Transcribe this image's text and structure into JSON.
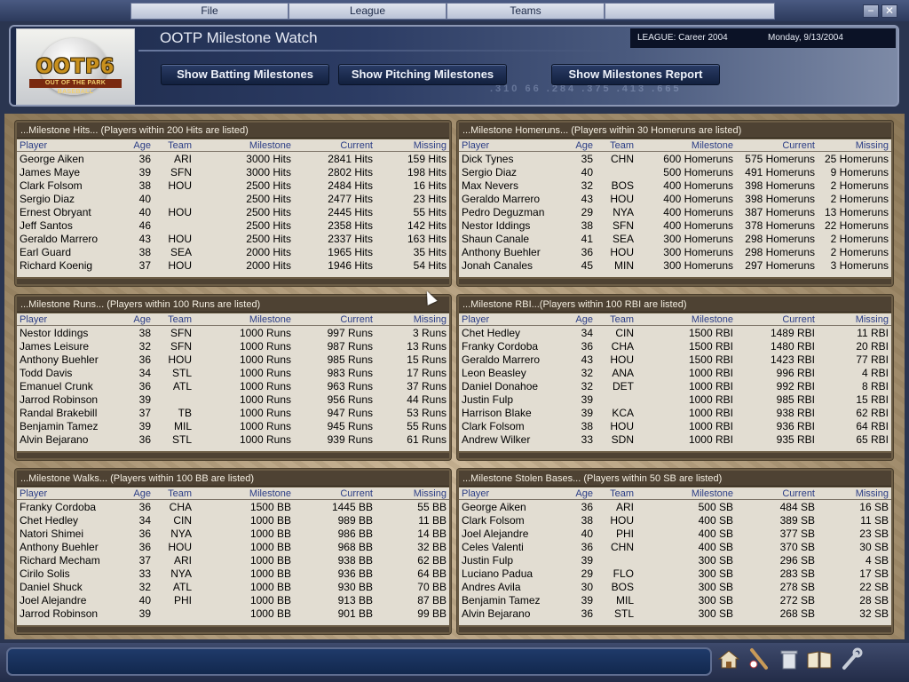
{
  "menu": {
    "items": [
      "File",
      "League",
      "Teams",
      ""
    ]
  },
  "window_controls": {
    "minimize": "−",
    "close": "✕"
  },
  "header": {
    "title": "OOTP Milestone Watch",
    "logo_text": "OOTP6",
    "logo_sub": "OUT OF THE PARK BASEBALL",
    "league": "LEAGUE: Career 2004",
    "date": "Monday, 9/13/2004",
    "buttons": {
      "batting": "Show Batting Milestones",
      "pitching": "Show Pitching Milestones",
      "report": "Show Milestones Report"
    },
    "bg_numbers": ".310  66  .284  .375  .413  .665"
  },
  "columns": {
    "player": "Player",
    "age": "Age",
    "team": "Team",
    "milestone": "Milestone",
    "current": "Current",
    "missing": "Missing"
  },
  "panels": {
    "hits": {
      "title": "...Milestone Hits... (Players within 200 Hits are listed)",
      "rows": [
        [
          "George Aiken",
          "36",
          "ARI",
          "3000 Hits",
          "2841 Hits",
          "159 Hits"
        ],
        [
          "James Maye",
          "39",
          "SFN",
          "3000 Hits",
          "2802 Hits",
          "198 Hits"
        ],
        [
          "Clark Folsom",
          "38",
          "HOU",
          "2500 Hits",
          "2484 Hits",
          "16 Hits"
        ],
        [
          "Sergio Diaz",
          "40",
          "",
          "2500 Hits",
          "2477 Hits",
          "23 Hits"
        ],
        [
          "Ernest Obryant",
          "40",
          "HOU",
          "2500 Hits",
          "2445 Hits",
          "55 Hits"
        ],
        [
          "Jeff Santos",
          "46",
          "",
          "2500 Hits",
          "2358 Hits",
          "142 Hits"
        ],
        [
          "Geraldo Marrero",
          "43",
          "HOU",
          "2500 Hits",
          "2337 Hits",
          "163 Hits"
        ],
        [
          "Earl Guard",
          "38",
          "SEA",
          "2000 Hits",
          "1965 Hits",
          "35 Hits"
        ],
        [
          "Richard Koenig",
          "37",
          "HOU",
          "2000 Hits",
          "1946 Hits",
          "54 Hits"
        ]
      ]
    },
    "homeruns": {
      "title": "...Milestone Homeruns... (Players within 30 Homeruns are listed)",
      "rows": [
        [
          "Dick Tynes",
          "35",
          "CHN",
          "600 Homeruns",
          "575 Homeruns",
          "25 Homeruns"
        ],
        [
          "Sergio Diaz",
          "40",
          "",
          "500 Homeruns",
          "491 Homeruns",
          "9 Homeruns"
        ],
        [
          "Max Nevers",
          "32",
          "BOS",
          "400 Homeruns",
          "398 Homeruns",
          "2 Homeruns"
        ],
        [
          "Geraldo Marrero",
          "43",
          "HOU",
          "400 Homeruns",
          "398 Homeruns",
          "2 Homeruns"
        ],
        [
          "Pedro Deguzman",
          "29",
          "NYA",
          "400 Homeruns",
          "387 Homeruns",
          "13 Homeruns"
        ],
        [
          "Nestor Iddings",
          "38",
          "SFN",
          "400 Homeruns",
          "378 Homeruns",
          "22 Homeruns"
        ],
        [
          "Shaun Canale",
          "41",
          "SEA",
          "300 Homeruns",
          "298 Homeruns",
          "2 Homeruns"
        ],
        [
          "Anthony Buehler",
          "36",
          "HOU",
          "300 Homeruns",
          "298 Homeruns",
          "2 Homeruns"
        ],
        [
          "Jonah Canales",
          "45",
          "MIN",
          "300 Homeruns",
          "297 Homeruns",
          "3 Homeruns"
        ]
      ]
    },
    "runs": {
      "title": "...Milestone Runs... (Players within 100 Runs are listed)",
      "rows": [
        [
          "Nestor Iddings",
          "38",
          "SFN",
          "1000 Runs",
          "997 Runs",
          "3 Runs"
        ],
        [
          "James Leisure",
          "32",
          "SFN",
          "1000 Runs",
          "987 Runs",
          "13 Runs"
        ],
        [
          "Anthony Buehler",
          "36",
          "HOU",
          "1000 Runs",
          "985 Runs",
          "15 Runs"
        ],
        [
          "Todd Davis",
          "34",
          "STL",
          "1000 Runs",
          "983 Runs",
          "17 Runs"
        ],
        [
          "Emanuel Crunk",
          "36",
          "ATL",
          "1000 Runs",
          "963 Runs",
          "37 Runs"
        ],
        [
          "Jarrod Robinson",
          "39",
          "",
          "1000 Runs",
          "956 Runs",
          "44 Runs"
        ],
        [
          "Randal Brakebill",
          "37",
          "TB",
          "1000 Runs",
          "947 Runs",
          "53 Runs"
        ],
        [
          "Benjamin Tamez",
          "39",
          "MIL",
          "1000 Runs",
          "945 Runs",
          "55 Runs"
        ],
        [
          "Alvin Bejarano",
          "36",
          "STL",
          "1000 Runs",
          "939 Runs",
          "61 Runs"
        ]
      ]
    },
    "rbi": {
      "title": "...Milestone RBI...(Players within 100 RBI are listed)",
      "rows": [
        [
          "Chet Hedley",
          "34",
          "CIN",
          "1500 RBI",
          "1489 RBI",
          "11 RBI"
        ],
        [
          "Franky Cordoba",
          "36",
          "CHA",
          "1500 RBI",
          "1480 RBI",
          "20 RBI"
        ],
        [
          "Geraldo Marrero",
          "43",
          "HOU",
          "1500 RBI",
          "1423 RBI",
          "77 RBI"
        ],
        [
          "Leon Beasley",
          "32",
          "ANA",
          "1000 RBI",
          "996 RBI",
          "4 RBI"
        ],
        [
          "Daniel Donahoe",
          "32",
          "DET",
          "1000 RBI",
          "992 RBI",
          "8 RBI"
        ],
        [
          "Justin Fulp",
          "39",
          "",
          "1000 RBI",
          "985 RBI",
          "15 RBI"
        ],
        [
          "Harrison Blake",
          "39",
          "KCA",
          "1000 RBI",
          "938 RBI",
          "62 RBI"
        ],
        [
          "Clark Folsom",
          "38",
          "HOU",
          "1000 RBI",
          "936 RBI",
          "64 RBI"
        ],
        [
          "Andrew Wilker",
          "33",
          "SDN",
          "1000 RBI",
          "935 RBI",
          "65 RBI"
        ]
      ]
    },
    "walks": {
      "title": "...Milestone Walks... (Players within 100 BB are listed)",
      "rows": [
        [
          "Franky Cordoba",
          "36",
          "CHA",
          "1500 BB",
          "1445 BB",
          "55 BB"
        ],
        [
          "Chet Hedley",
          "34",
          "CIN",
          "1000 BB",
          "989 BB",
          "11 BB"
        ],
        [
          "Natori Shimei",
          "36",
          "NYA",
          "1000 BB",
          "986 BB",
          "14 BB"
        ],
        [
          "Anthony Buehler",
          "36",
          "HOU",
          "1000 BB",
          "968 BB",
          "32 BB"
        ],
        [
          "Richard Mecham",
          "37",
          "ARI",
          "1000 BB",
          "938 BB",
          "62 BB"
        ],
        [
          "Cirilo Solis",
          "33",
          "NYA",
          "1000 BB",
          "936 BB",
          "64 BB"
        ],
        [
          "Daniel Shuck",
          "32",
          "ATL",
          "1000 BB",
          "930 BB",
          "70 BB"
        ],
        [
          "Joel Alejandre",
          "40",
          "PHI",
          "1000 BB",
          "913 BB",
          "87 BB"
        ],
        [
          "Jarrod Robinson",
          "39",
          "",
          "1000 BB",
          "901 BB",
          "99 BB"
        ]
      ]
    },
    "stolen_bases": {
      "title": "...Milestone Stolen Bases... (Players within 50 SB are listed)",
      "rows": [
        [
          "George Aiken",
          "36",
          "ARI",
          "500 SB",
          "484 SB",
          "16 SB"
        ],
        [
          "Clark Folsom",
          "38",
          "HOU",
          "400 SB",
          "389 SB",
          "11 SB"
        ],
        [
          "Joel Alejandre",
          "40",
          "PHI",
          "400 SB",
          "377 SB",
          "23 SB"
        ],
        [
          "Celes Valenti",
          "36",
          "CHN",
          "400 SB",
          "370 SB",
          "30 SB"
        ],
        [
          "Justin Fulp",
          "39",
          "",
          "300 SB",
          "296 SB",
          "4 SB"
        ],
        [
          "Luciano Padua",
          "29",
          "FLO",
          "300 SB",
          "283 SB",
          "17 SB"
        ],
        [
          "Andres Avila",
          "30",
          "BOS",
          "300 SB",
          "278 SB",
          "22 SB"
        ],
        [
          "Benjamin Tamez",
          "39",
          "MIL",
          "300 SB",
          "272 SB",
          "28 SB"
        ],
        [
          "Alvin Bejarano",
          "36",
          "STL",
          "300 SB",
          "268 SB",
          "32 SB"
        ]
      ]
    }
  },
  "bottom_icons": [
    "home-icon",
    "baseball-bat-icon",
    "trash-can-icon",
    "book-icon",
    "wrench-icon"
  ],
  "colors": {
    "header_text": "#2c3e86",
    "panel_frame": "#6b5c45",
    "panel_title_bg": "#4e4233",
    "accent_blue": "#1d2a4a"
  }
}
